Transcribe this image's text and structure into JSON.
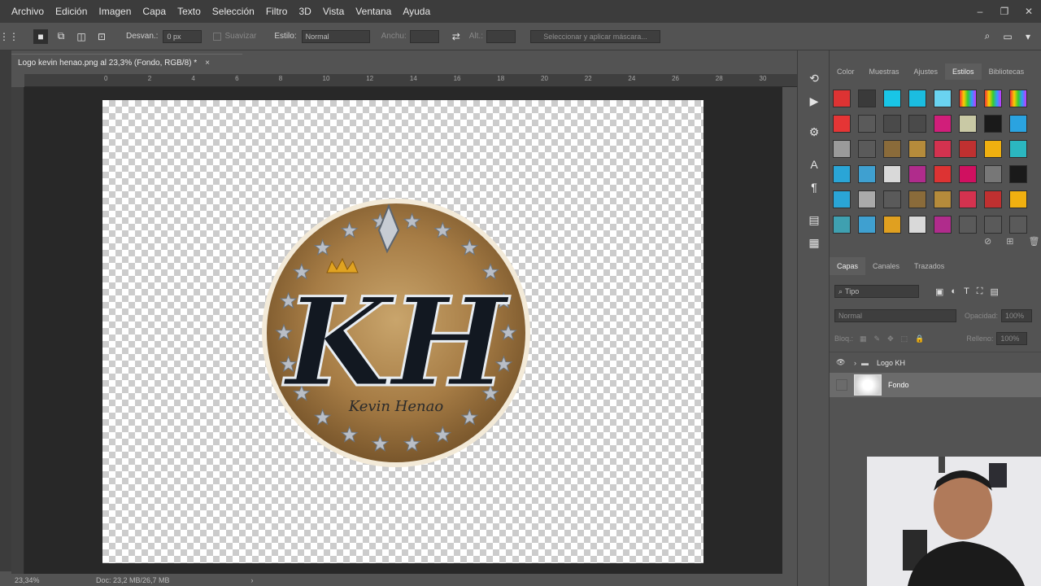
{
  "menu": [
    "Archivo",
    "Edición",
    "Imagen",
    "Capa",
    "Texto",
    "Selección",
    "Filtro",
    "3D",
    "Vista",
    "Ventana",
    "Ayuda"
  ],
  "window_controls": [
    "–",
    "❐",
    "✕"
  ],
  "options": {
    "feather_label": "Desvan.:",
    "feather_value": "0 px",
    "smooth_label": "Suavizar",
    "style_label": "Estilo:",
    "style_value": "Normal",
    "width_label": "Anchu:",
    "height_label": "Alt.:",
    "mask_button": "Seleccionar y aplicar máscara..."
  },
  "document": {
    "tab_title": "Logo kevin henao.png al 23,3% (Fondo, RGB/8) *",
    "close": "×"
  },
  "ruler_marks": [
    "0",
    "2",
    "4",
    "6",
    "8",
    "10",
    "12",
    "14",
    "16",
    "18",
    "20",
    "22",
    "24",
    "26",
    "28",
    "30"
  ],
  "logo": {
    "initials": "KH",
    "signature": "Kevin Henao"
  },
  "status": {
    "zoom": "23,34%",
    "doc": "Doc: 23,2 MB/26,7 MB"
  },
  "panels": {
    "tabs": [
      "Color",
      "Muestras",
      "Ajustes",
      "Estilos",
      "Bibliotecas"
    ],
    "active_tab": "Estilos"
  },
  "style_swatches": [
    "#d33",
    "#3a3a3a",
    "#19c5e6",
    "#1bbde0",
    "#6ad3f0",
    "rainbow",
    "rainbow",
    "rainbow",
    "#e53535",
    "#5a5a5a",
    "#4a4a4a",
    "#4a4a4a",
    "#d11e7a",
    "#c9c9a5",
    "#1a1a1a",
    "#2aa3e0",
    "#9a9a9a",
    "#5a5a5a",
    "#8a6b3a",
    "#b58b3b",
    "#d4324f",
    "#c03030",
    "#f0b010",
    "#2bb7c0",
    "#2aa5d6",
    "#3fa0d0",
    "#d9d9d9",
    "#b02c8c",
    "#d33",
    "#d01060",
    "#777",
    "#1a1a1a",
    "#2aa5d6",
    "#aaa",
    "#5a5a5a",
    "#8a6b3a",
    "#b58b3b",
    "#d4324f",
    "#c03030",
    "#f0b010",
    "#3fa0b0",
    "#3fa0d0",
    "#e0a020",
    "#d9d9d9",
    "#b02c8c",
    "#5a5a5a",
    "#5a5a5a",
    "#5a5a5a"
  ],
  "layers": {
    "tabs": [
      "Capas",
      "Canales",
      "Trazados"
    ],
    "active_tab": "Capas",
    "filter_label": "Tipo",
    "blend_mode": "Normal",
    "opacity_label": "Opacidad:",
    "opacity_value": "100%",
    "lock_label": "Bloq.:",
    "fill_label": "Relleno:",
    "fill_value": "100%",
    "items": [
      {
        "name": "Logo KH",
        "type": "group"
      },
      {
        "name": "Fondo",
        "type": "layer"
      }
    ]
  }
}
